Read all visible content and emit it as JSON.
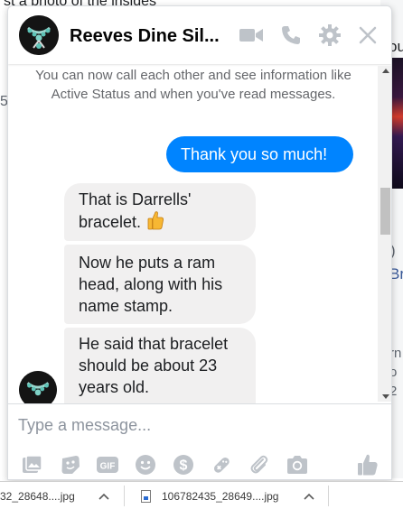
{
  "background": {
    "top_text": "st a photo of the insides",
    "left_fragment": "5",
    "right_fragments": {
      "top": "ou",
      "paren": ")",
      "link": "Br",
      "rows": [
        "rn",
        "o",
        "2"
      ]
    }
  },
  "chat": {
    "title": "Reeves Dine Sil...",
    "header_icons": [
      "video-camera-icon",
      "phone-icon",
      "gear-icon",
      "close-icon"
    ],
    "system_note": "You can now call each other and see information like Active Status and when you've read messages.",
    "messages": [
      {
        "direction": "outgoing",
        "text": "Thank you so much!"
      },
      {
        "direction": "incoming",
        "text": "That is Darrells' bracelet.",
        "emoji": "thumbs-up-icon"
      },
      {
        "direction": "incoming",
        "text": "Now he puts a ram head, along with his name stamp."
      },
      {
        "direction": "incoming",
        "text": "He said that bracelet should be about 23 years old."
      }
    ],
    "composer": {
      "placeholder": "Type a message...",
      "tools": [
        "photo-icon",
        "sticker-icon",
        "gif-icon",
        "emoji-icon",
        "dollar-icon",
        "game-controller-icon",
        "attachment-icon",
        "camera-icon",
        "like-icon"
      ]
    },
    "colors": {
      "outgoing_bubble": "#0084ff",
      "incoming_bubble": "#f1f0f0",
      "icon_gray": "#bec3c9"
    }
  },
  "downloads": [
    {
      "name": "32_28648....jpg"
    },
    {
      "name": "106782435_28649....jpg"
    }
  ]
}
